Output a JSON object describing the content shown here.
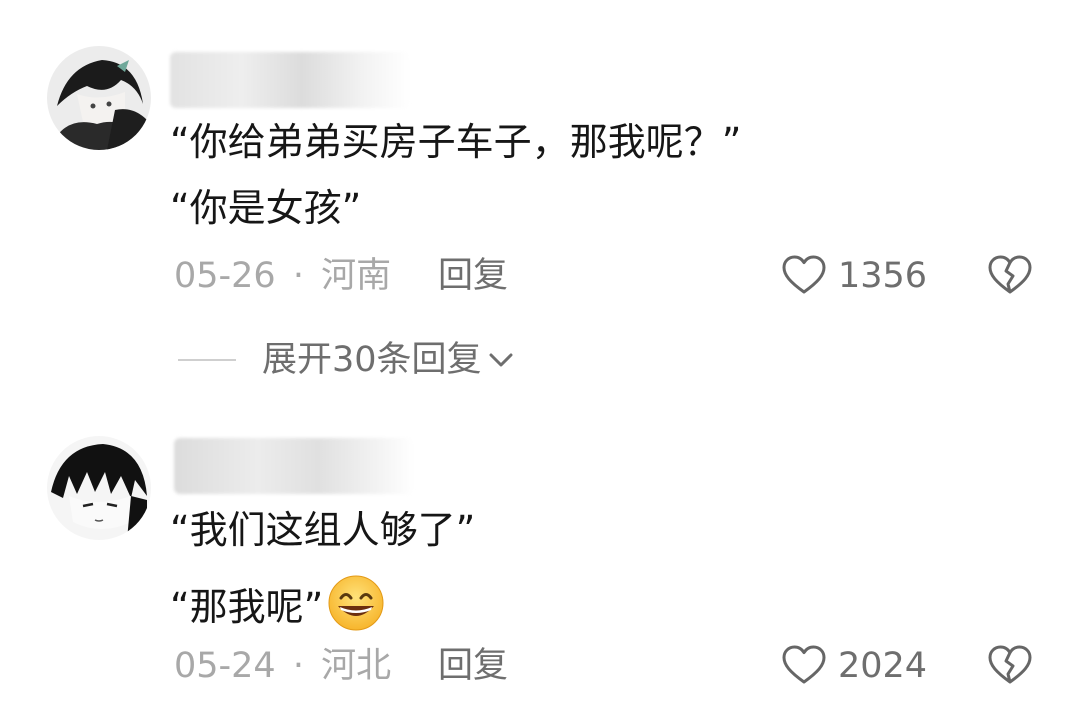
{
  "comments": [
    {
      "lines": [
        "“你给弟弟买房子车子，那我呢？”",
        "“你是女孩”"
      ],
      "date": "05-26",
      "separator": "·",
      "location": "河南",
      "reply_label": "回复",
      "likes": "1356",
      "expand_label": "展开30条回复"
    },
    {
      "lines": [
        "“我们这组人够了”",
        "“那我呢”"
      ],
      "date": "05-24",
      "separator": "·",
      "location": "河北",
      "reply_label": "回复",
      "likes": "2024"
    }
  ],
  "icons": {
    "like": "heart-outline-icon",
    "dislike": "broken-heart-icon",
    "expand": "chevron-down-icon",
    "emoji": "grinning-face-emoji"
  },
  "colors": {
    "text_primary": "#161616",
    "text_meta": "#a8a8a8",
    "text_action": "#6e6e6e"
  }
}
